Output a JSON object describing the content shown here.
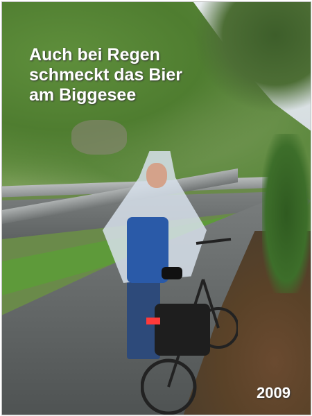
{
  "caption": {
    "lines": [
      "Auch bei Regen",
      "schmeckt das Bier",
      "am Biggesee"
    ]
  },
  "year": "2009"
}
